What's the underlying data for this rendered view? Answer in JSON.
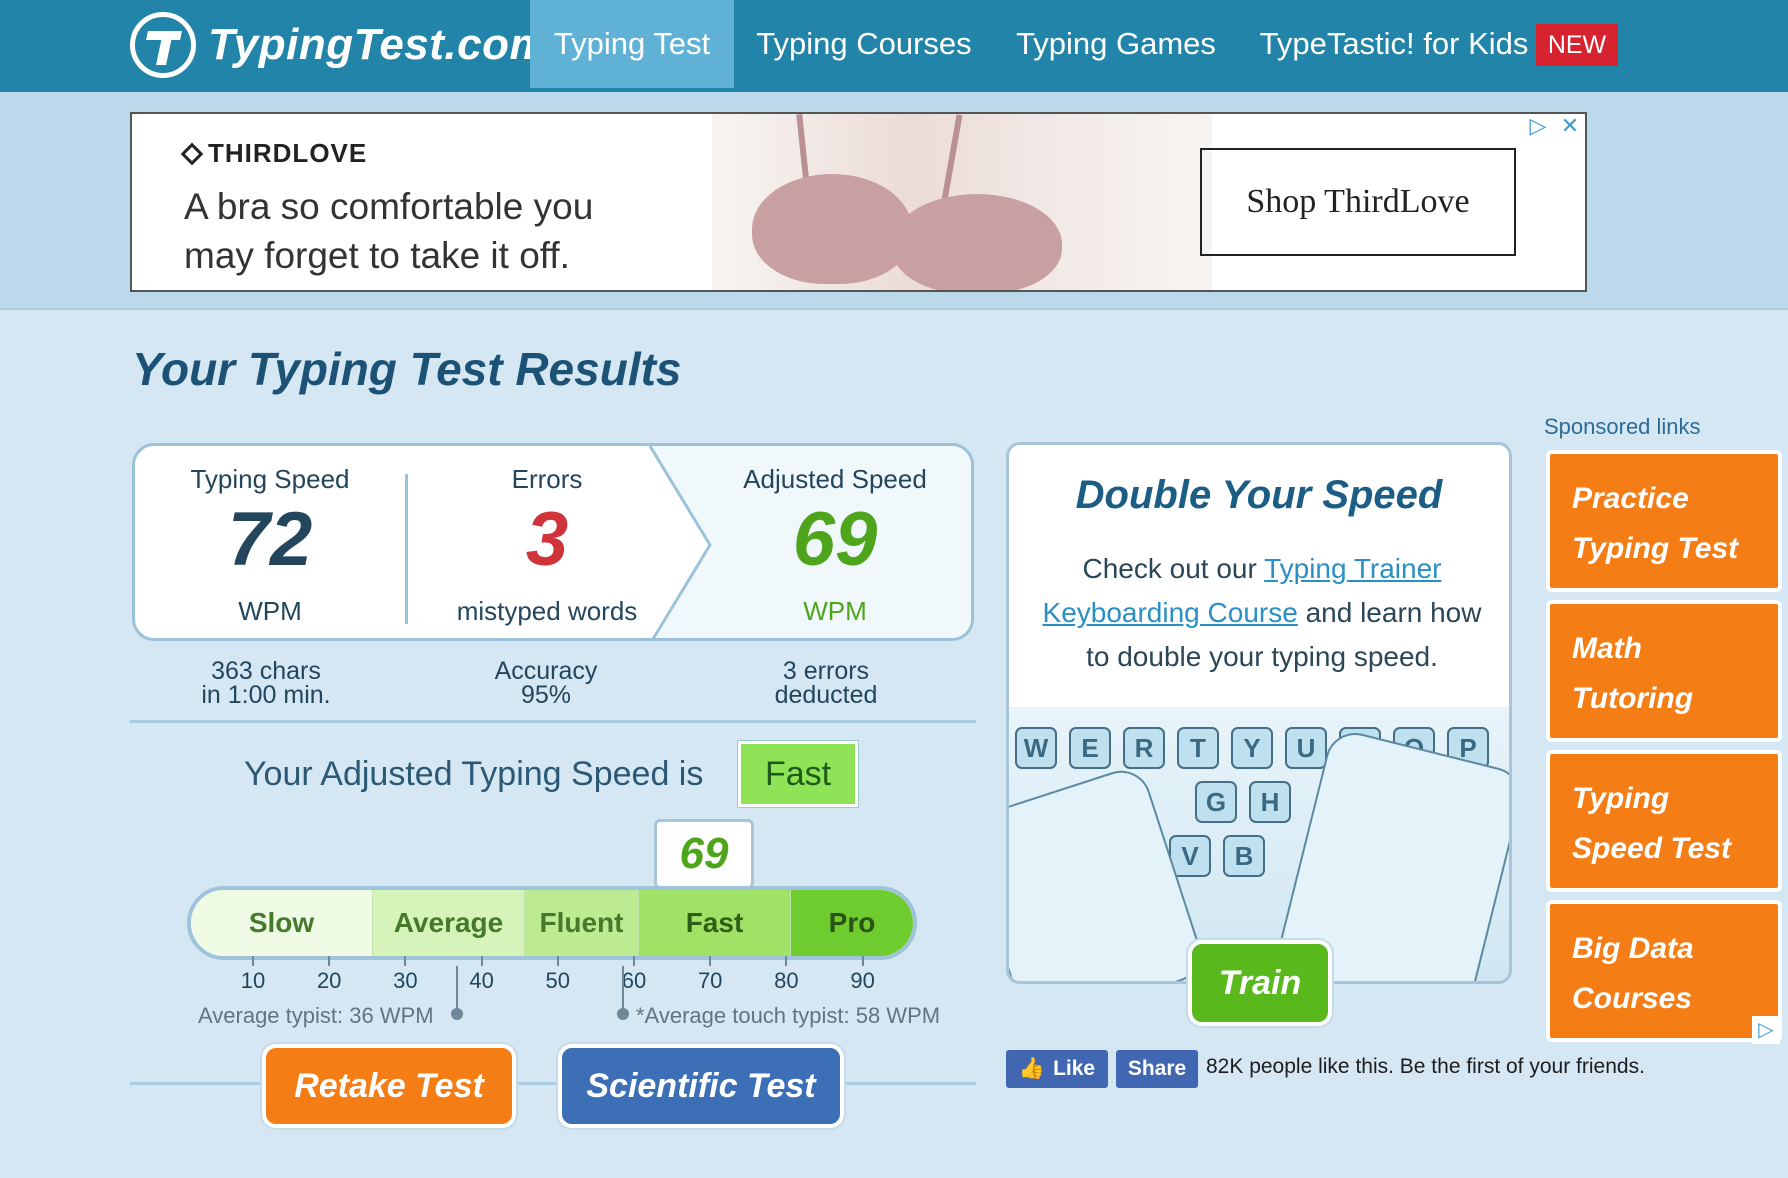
{
  "header": {
    "logo_text": "TypingTest.com",
    "nav": [
      {
        "label": "Typing Test",
        "active": true
      },
      {
        "label": "Typing Courses"
      },
      {
        "label": "Typing Games"
      },
      {
        "label": "TypeTastic! for Kids"
      }
    ],
    "new_badge": "NEW"
  },
  "ad": {
    "brand": "THIRDLOVE",
    "copy_line1": "A bra so comfortable you",
    "copy_line2": "may forget to take it off.",
    "cta": "Shop ThirdLove",
    "adchoices_icon": "adchoices-icon",
    "close_icon": "close-icon"
  },
  "results": {
    "title": "Your Typing Test Results",
    "speed": {
      "caption": "Typing Speed",
      "value": "72",
      "unit": "WPM",
      "detail1": "363 chars",
      "detail2": "in 1:00 min."
    },
    "errors": {
      "caption": "Errors",
      "value": "3",
      "unit": "mistyped words",
      "detail1": "Accuracy",
      "detail2": "95%"
    },
    "adjusted": {
      "caption": "Adjusted Speed",
      "value": "69",
      "unit": "WPM",
      "detail1": "3 errors",
      "detail2": "deducted"
    },
    "adjusted_label": "Your Adjusted Typing Speed is",
    "adjusted_badge": "Fast",
    "marker_value": "69",
    "scale_segments": [
      {
        "label": "Slow",
        "color": "#effbe4"
      },
      {
        "label": "Average",
        "color": "#d6f3b9"
      },
      {
        "label": "Fluent",
        "color": "#bdeb92"
      },
      {
        "label": "Fast",
        "color": "#9fe265"
      },
      {
        "label": "Pro",
        "color": "#6fcc2f"
      }
    ],
    "ticks": [
      "10",
      "20",
      "30",
      "40",
      "50",
      "60",
      "70",
      "80",
      "90"
    ],
    "average_note": "Average typist: 36 WPM",
    "touch_note": "*Average touch typist: 58 WPM",
    "retake_label": "Retake Test",
    "scientific_label": "Scientific Test"
  },
  "promo": {
    "title": "Double Your Speed",
    "text_before": "Check out our ",
    "link_text": "Typing Trainer Keyboarding Course",
    "text_after": " and learn how to double your typing speed.",
    "train_label": "Train",
    "keys_top": [
      "W",
      "E",
      "R",
      "T",
      "Y",
      "U",
      "I",
      "O",
      "P"
    ],
    "keys_mid": [
      "G",
      "H"
    ],
    "keys_bot": [
      "V",
      "B"
    ]
  },
  "social": {
    "like": "Like",
    "share": "Share",
    "text": "82K people like this. Be the first of your friends."
  },
  "sponsored": {
    "label": "Sponsored links",
    "links": [
      {
        "line1": "Practice",
        "line2": "Typing Test"
      },
      {
        "line1": "Math",
        "line2": "Tutoring"
      },
      {
        "line1": "Typing",
        "line2": "Speed Test"
      },
      {
        "line1": "Big Data",
        "line2": "Courses"
      }
    ]
  },
  "colors": {
    "header": "#2384aa",
    "speed": "#23465c",
    "errors": "#d0333a",
    "adjusted": "#4ea51c",
    "orange": "#f57d16",
    "blue": "#3d6fb7",
    "green": "#59b91c"
  }
}
